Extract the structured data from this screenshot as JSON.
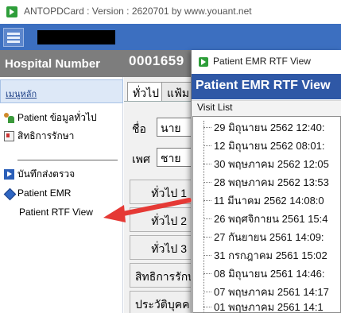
{
  "app": {
    "title": "ANTOPDCard : Version : 2620701 by www.youant.net"
  },
  "header": {
    "hospital_number_label": "Hospital Number",
    "hospital_number_value": "0001659"
  },
  "sidebar": {
    "header": "เมนูหลัก",
    "items": [
      {
        "label": "Patient ข้อมูลทั่วไป",
        "icon": "people-icon"
      },
      {
        "label": "สิทธิการรักษา",
        "icon": "card-icon"
      },
      {
        "label": "บันทึกส่งตรวจ",
        "icon": "play-icon"
      },
      {
        "label": "Patient EMR",
        "icon": "diamond-icon"
      },
      {
        "label": "Patient RTF View",
        "icon": ""
      }
    ]
  },
  "main": {
    "tabs": [
      "ทั่วไป",
      "แฟ้ม"
    ],
    "name_label": "ชื่อ",
    "name_value": "นาย",
    "sex_label": "เพศ",
    "sex_value": "ชาย",
    "side_buttons": [
      "ทั่วไป 1",
      "ทั่วไป 2",
      "ทั่วไป 3",
      "สิทธิการรักษ",
      "ประวัติบุคค"
    ]
  },
  "rtf_window": {
    "title": "Patient EMR RTF View",
    "header": "Patient EMR RTF View",
    "visit_list_label": "Visit List",
    "visits": [
      "29 มิถุนายน 2562 12:40:",
      "12 มิถุนายน 2562 08:01:",
      "30 พฤษภาคม 2562 12:05",
      "28 พฤษภาคม 2562 13:53",
      "11 มีนาคม 2562 14:08:0",
      "26 พฤศจิกายน 2561 15:4",
      "27 กันยายน 2561 14:09:",
      "31 กรกฎาคม 2561 15:02",
      "08 มิถุนายน 2561 14:46:",
      "07 พฤษภาคม 2561 14:17",
      "01 พฤษภาคม 2561 14:1"
    ]
  },
  "colors": {
    "toolbar_blue": "#3c6fc0",
    "rtf_header_blue": "#2f58a6",
    "hn_bar_gray": "#7d7d7d",
    "arrow_red": "#e53935"
  }
}
